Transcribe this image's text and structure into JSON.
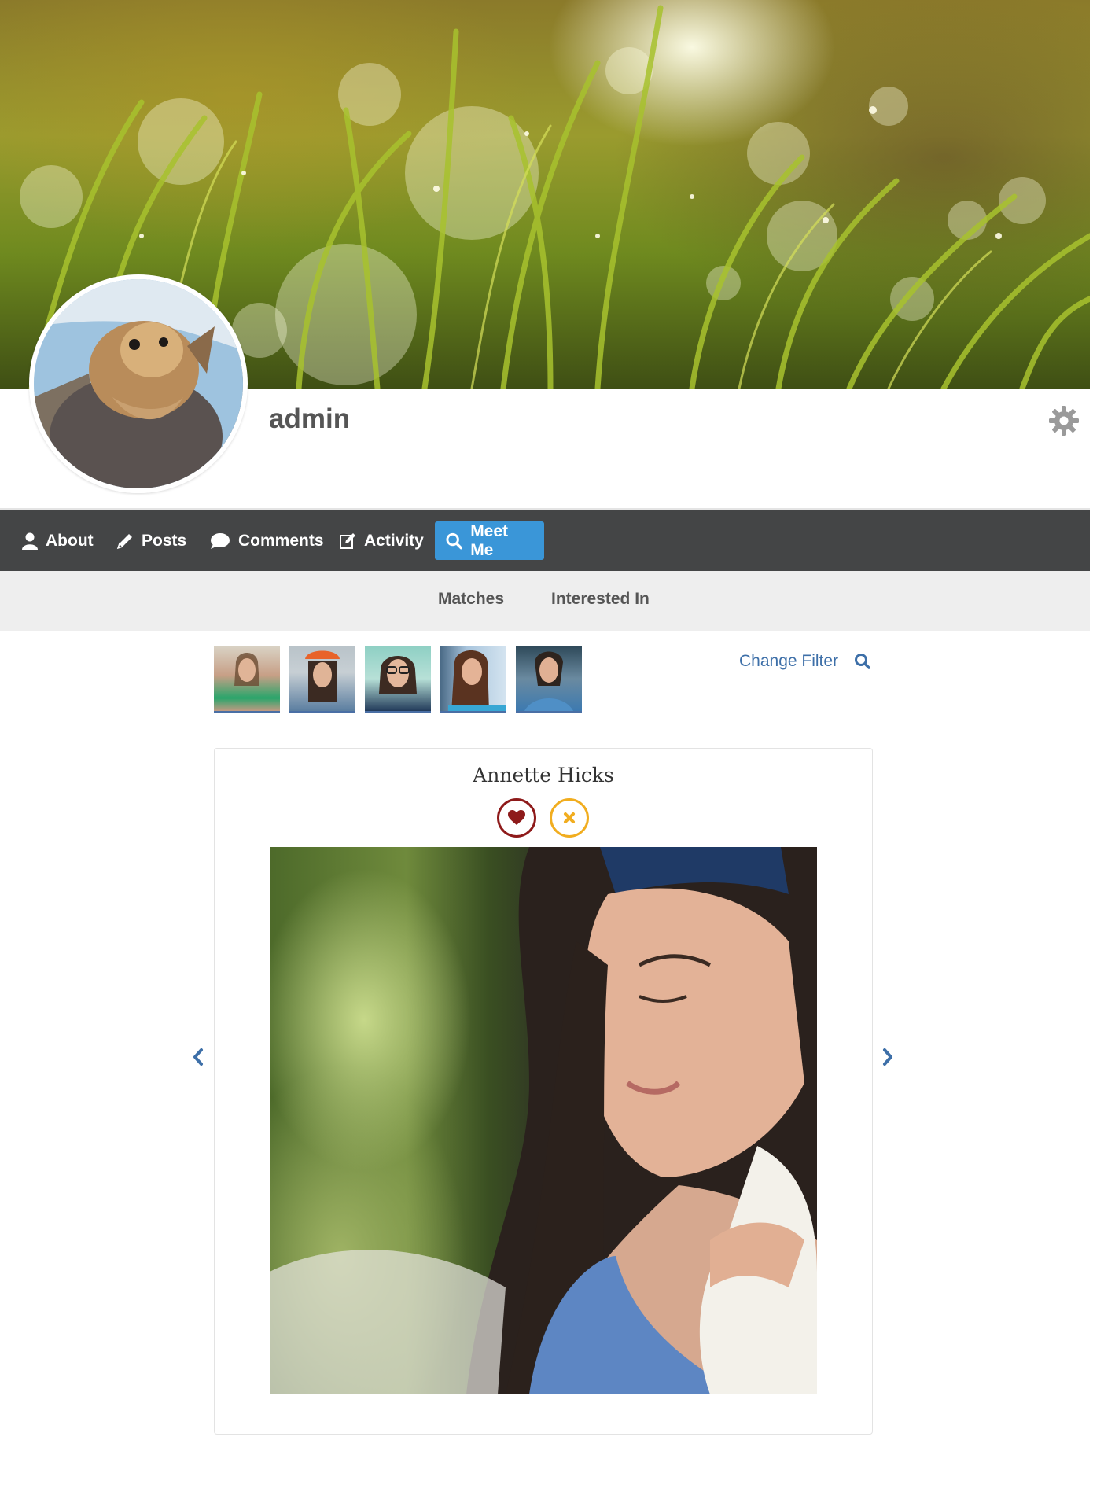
{
  "profile": {
    "username": "admin"
  },
  "nav": {
    "items": [
      {
        "label": "About",
        "icon": "user-icon"
      },
      {
        "label": "Posts",
        "icon": "pencil-icon"
      },
      {
        "label": "Comments",
        "icon": "comment-icon"
      },
      {
        "label": "Activity",
        "icon": "edit-icon"
      },
      {
        "label": "Meet Me",
        "icon": "search-icon",
        "active": true
      }
    ],
    "active_color": "#3a96d8"
  },
  "subtabs": {
    "items": [
      {
        "label": "Matches"
      },
      {
        "label": "Interested In"
      }
    ]
  },
  "filter": {
    "label": "Change Filter",
    "icon": "search-icon"
  },
  "thumbnails": [
    {
      "name": "thumb-1"
    },
    {
      "name": "thumb-2"
    },
    {
      "name": "thumb-3"
    },
    {
      "name": "thumb-4"
    },
    {
      "name": "thumb-5"
    }
  ],
  "match": {
    "name": "Annette Hicks",
    "like_icon": "heart-icon",
    "pass_icon": "close-icon",
    "like_color": "#8e1a1a",
    "pass_color": "#f1ad1f"
  },
  "pager": {
    "prev_icon": "chevron-left-icon",
    "next_icon": "chevron-right-icon"
  }
}
